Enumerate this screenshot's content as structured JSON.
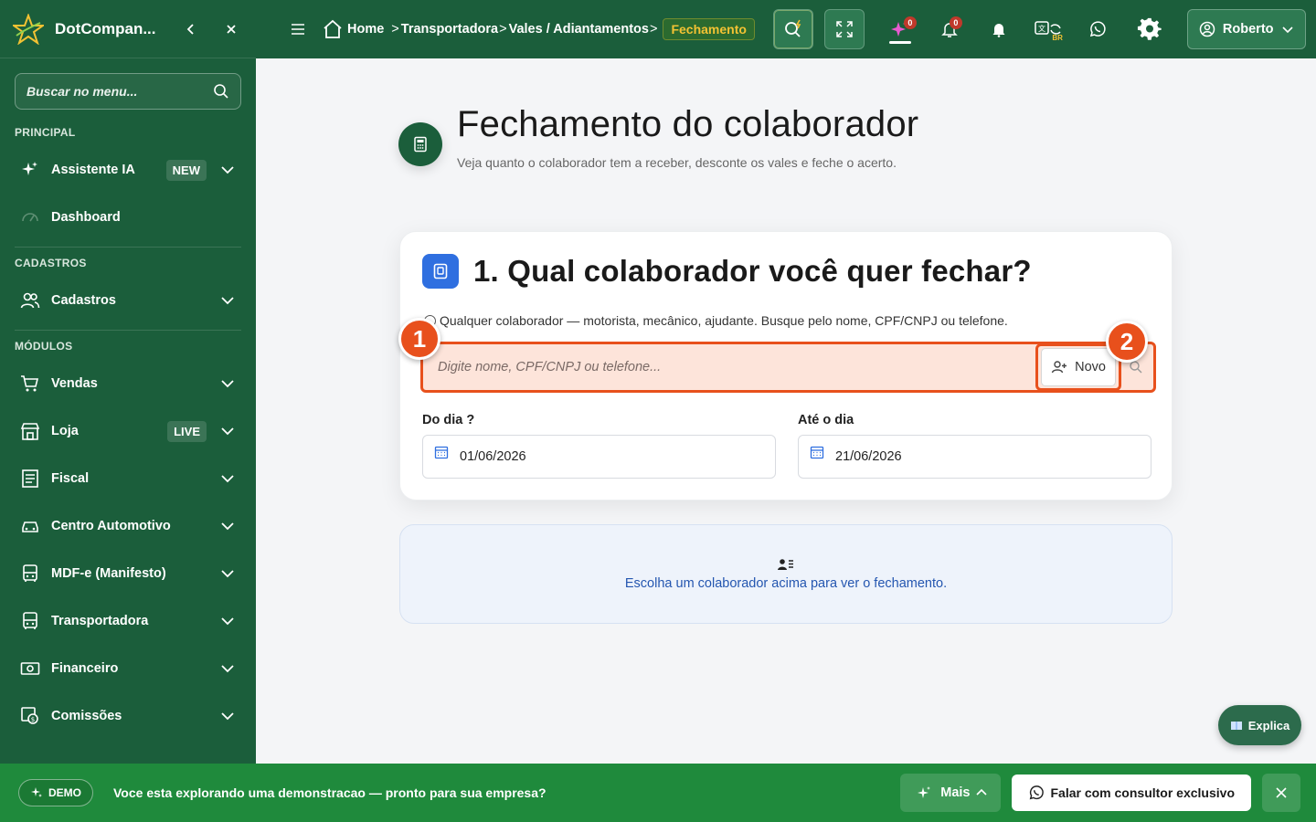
{
  "sidebar": {
    "brand": "DotCompan...",
    "search_placeholder": "Buscar no menu...",
    "sections": {
      "principal": "PRINCIPAL",
      "cadastros": "CADASTROS",
      "modulos": "MÓDULOS"
    },
    "items": [
      {
        "label": "Assistente IA",
        "badge": "NEW"
      },
      {
        "label": "Dashboard"
      },
      {
        "label": "Cadastros"
      },
      {
        "label": "Vendas"
      },
      {
        "label": "Loja",
        "badge": "LIVE"
      },
      {
        "label": "Fiscal"
      },
      {
        "label": "Centro Automotivo"
      },
      {
        "label": "MDF-e (Manifesto)"
      },
      {
        "label": "Transportadora"
      },
      {
        "label": "Financeiro"
      },
      {
        "label": "Comissões"
      }
    ]
  },
  "topbar": {
    "breadcrumbs": [
      "Home",
      "Transportadora",
      "Vales / Adiantamentos"
    ],
    "breadcrumb_active": "Fechamento",
    "ai_count": "0",
    "notif_count": "0",
    "lang_tag": "BR",
    "user": "Roberto"
  },
  "page": {
    "title": "Fechamento do colaborador",
    "subtitle": "Veja quanto o colaborador tem a receber, desconte os vales e feche o acerto."
  },
  "card": {
    "title": "1. Qual colaborador você quer fechar?",
    "hint": "Qualquer colaborador — motorista, mecânico, ajudante. Busque pelo nome, CPF/CNPJ ou telefone.",
    "search_placeholder": "Digite nome, CPF/CNPJ ou telefone...",
    "novo_label": "Novo",
    "marker1": "1",
    "marker2": "2",
    "date_from_label": "Do dia ?",
    "date_from_value": "01/06/2026",
    "date_to_label": "Até o dia",
    "date_to_value": "21/06/2026"
  },
  "empty_state": {
    "text": "Escolha um colaborador acima para ver o fechamento."
  },
  "explica_label": "Explica",
  "demo_bar": {
    "badge": "DEMO",
    "text_pre": "Voce esta explorando uma ",
    "text_bold": "demonstracao",
    "text_post": " — pronto para sua empresa?",
    "mais_label": "Mais",
    "consult_label": "Falar com consultor exclusivo"
  },
  "colors": {
    "brand_green": "#1b5e3b",
    "demo_green": "#1f8a3c",
    "highlight_orange": "#e8501c",
    "accent_yellow": "#f3c233",
    "link_blue": "#2456b0"
  }
}
